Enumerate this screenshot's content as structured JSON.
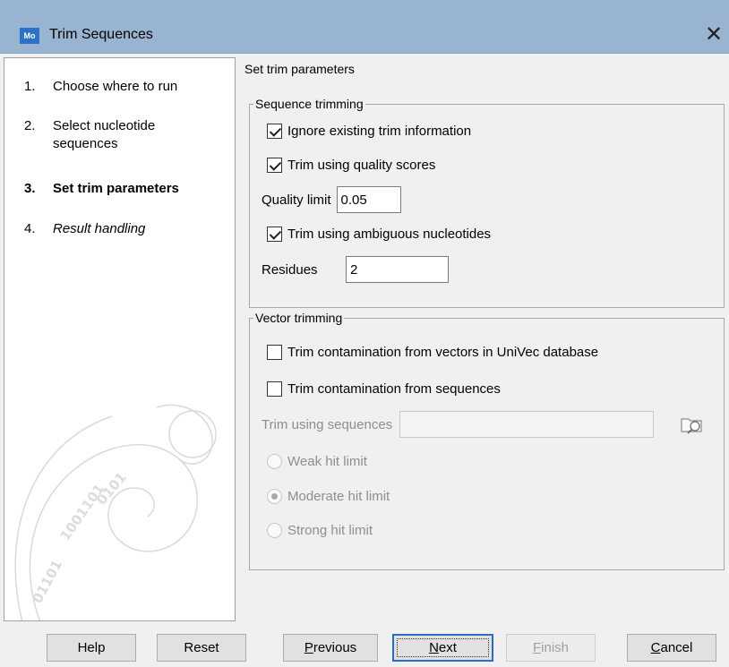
{
  "window": {
    "app_icon_text": "Mo",
    "title": "Trim Sequences",
    "close_glyph": "✕"
  },
  "steps": [
    {
      "num": "1.",
      "label": "Choose where to run"
    },
    {
      "num": "2.",
      "label": "Select nucleotide sequences"
    },
    {
      "num": "3.",
      "label": "Set trim parameters"
    },
    {
      "num": "4.",
      "label": "Result handling"
    }
  ],
  "main": {
    "section_title": "Set trim parameters",
    "sequence_trimming": {
      "legend": "Sequence trimming",
      "ignore_trim": {
        "label": "Ignore existing trim information",
        "checked": true
      },
      "quality_scores": {
        "label": "Trim using quality scores",
        "checked": true
      },
      "quality_limit": {
        "label": "Quality limit",
        "value": "0.05"
      },
      "ambiguous": {
        "label": "Trim using ambiguous nucleotides",
        "checked": true
      },
      "residues": {
        "label": "Residues",
        "value": "2"
      }
    },
    "vector_trimming": {
      "legend": "Vector trimming",
      "univec": {
        "label": "Trim contamination from vectors in UniVec database",
        "checked": false
      },
      "from_sequences": {
        "label": "Trim contamination from sequences",
        "checked": false
      },
      "trim_using": {
        "label": "Trim using sequences",
        "value": ""
      },
      "hit_limits": [
        {
          "label": "Weak hit limit",
          "selected": false
        },
        {
          "label": "Moderate hit limit",
          "selected": true
        },
        {
          "label": "Strong hit limit",
          "selected": false
        }
      ]
    }
  },
  "buttons": {
    "help": "Help",
    "reset": "Reset",
    "previous_mnemonic": "P",
    "previous_rest": "revious",
    "next_mnemonic": "N",
    "next_rest": "ext",
    "finish_mnemonic": "F",
    "finish_rest": "inish",
    "cancel_mnemonic": "C",
    "cancel_rest": "ancel"
  },
  "icons": {
    "browse": "browse-folder-icon",
    "close": "close-icon"
  }
}
